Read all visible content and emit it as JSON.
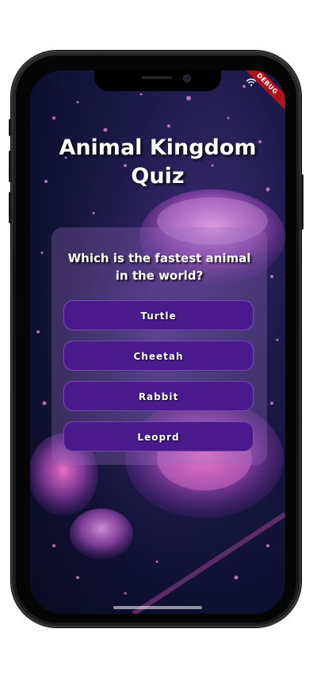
{
  "status_bar": {
    "time": "9:41",
    "wifi_icon": "wifi-icon"
  },
  "debug_banner": {
    "label": "DEBUG"
  },
  "quiz": {
    "title_line1": "Animal Kingdom",
    "title_line2": "Quiz",
    "question_line1": "Which is the fastest animal",
    "question_line2": "in the world?",
    "answers": [
      {
        "label": "Turtle"
      },
      {
        "label": "Cheetah"
      },
      {
        "label": "Rabbit"
      },
      {
        "label": "Leoprd"
      }
    ]
  },
  "colors": {
    "answer_button": "#4a1a8c",
    "card_overlay": "#966ebe",
    "title_text": "#ffffff",
    "debug_banner": "#b0121b",
    "background": "#1c1a4a",
    "jellyfish": "#d65ce0"
  }
}
